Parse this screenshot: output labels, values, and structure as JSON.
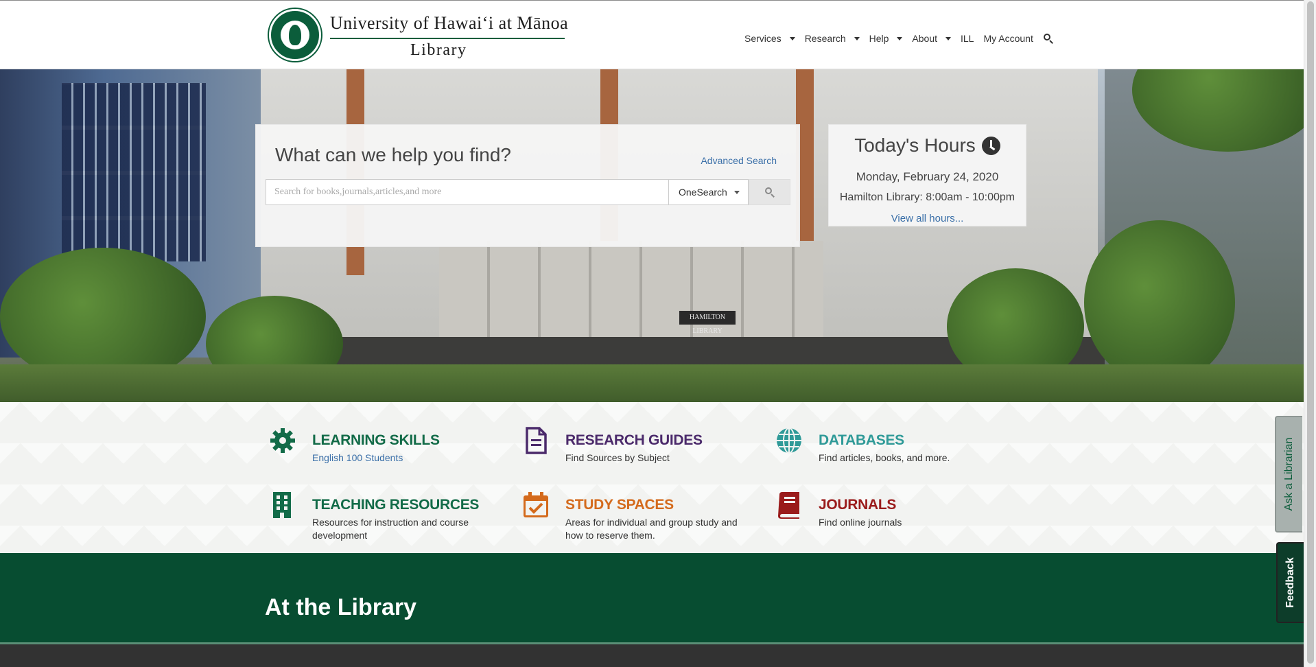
{
  "header": {
    "logo_line1": "University of Hawaiʻi at Mānoa",
    "logo_line2": "Library",
    "nav": [
      {
        "label": "Services",
        "dropdown": true
      },
      {
        "label": "Research",
        "dropdown": true
      },
      {
        "label": "Help",
        "dropdown": true
      },
      {
        "label": "About",
        "dropdown": true
      },
      {
        "label": "ILL",
        "dropdown": false
      },
      {
        "label": "My Account",
        "dropdown": false
      }
    ],
    "search_icon": "search-icon"
  },
  "hero": {
    "building_sign": "HAMILTON LIBRARY"
  },
  "search": {
    "title": "What can we help you find?",
    "advanced_link": "Advanced Search",
    "placeholder": "Search for books,journals,articles,and more",
    "scope": "OneSearch"
  },
  "hours": {
    "title": "Today's Hours",
    "date": "Monday, February 24, 2020",
    "line": "Hamilton Library: 8:00am - 10:00pm",
    "link": "View all hours..."
  },
  "quick_links": [
    {
      "title": "LEARNING SKILLS",
      "subtitle": "English 100 Students",
      "icon": "gear-icon",
      "color": "#126b48",
      "sub_color": "#3a6fa8"
    },
    {
      "title": "RESEARCH GUIDES",
      "subtitle": "Find Sources by Subject",
      "icon": "document-icon",
      "color": "#4b2a6b",
      "sub_color": "#333333"
    },
    {
      "title": "DATABASES",
      "subtitle": "Find articles, books, and more.",
      "icon": "globe-icon",
      "color": "#2f9a98",
      "sub_color": "#333333"
    },
    {
      "title": "TEACHING RESOURCES",
      "subtitle": "Resources for instruction and course development",
      "icon": "building-icon",
      "color": "#126b48",
      "sub_color": "#333333"
    },
    {
      "title": "STUDY SPACES",
      "subtitle": "Areas for individual and group study and how to reserve them.",
      "icon": "calendar-check-icon",
      "color": "#d46a1c",
      "sub_color": "#333333"
    },
    {
      "title": "JOURNALS",
      "subtitle": "Find online journals",
      "icon": "book-icon",
      "color": "#9a1b1b",
      "sub_color": "#333333"
    }
  ],
  "section": {
    "title": "At the Library"
  },
  "side_tabs": {
    "ask": "Ask a Librarian",
    "feedback": "Feedback"
  },
  "colors": {
    "brand_green": "#074d31",
    "link_blue": "#3a6fa8"
  }
}
